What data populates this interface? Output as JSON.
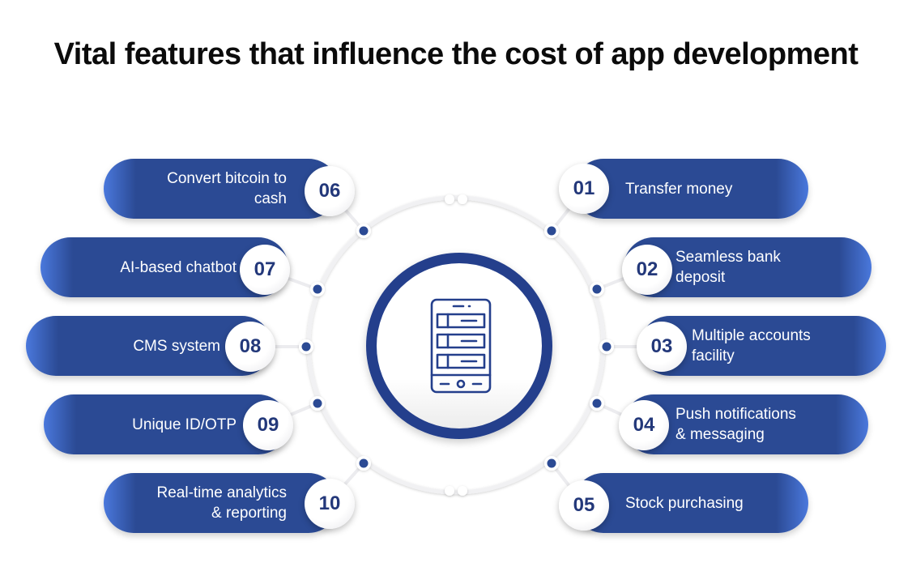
{
  "title": "Vital features that influence the cost of app development",
  "colors": {
    "primary": "#2b4a94",
    "accent_light": "#4a78dc",
    "number_text": "#23387a"
  },
  "center_icon": "mobile-app-icon",
  "features": [
    {
      "number": "01",
      "label": "Transfer money"
    },
    {
      "number": "02",
      "label": "Seamless bank\ndeposit"
    },
    {
      "number": "03",
      "label": "Multiple accounts\nfacility"
    },
    {
      "number": "04",
      "label": "Push notifications\n& messaging"
    },
    {
      "number": "05",
      "label": "Stock purchasing"
    },
    {
      "number": "06",
      "label": "Convert bitcoin to\ncash"
    },
    {
      "number": "07",
      "label": "AI-based chatbot"
    },
    {
      "number": "08",
      "label": "CMS system"
    },
    {
      "number": "09",
      "label": "Unique ID/OTP"
    },
    {
      "number": "10",
      "label": "Real-time analytics\n& reporting"
    }
  ]
}
